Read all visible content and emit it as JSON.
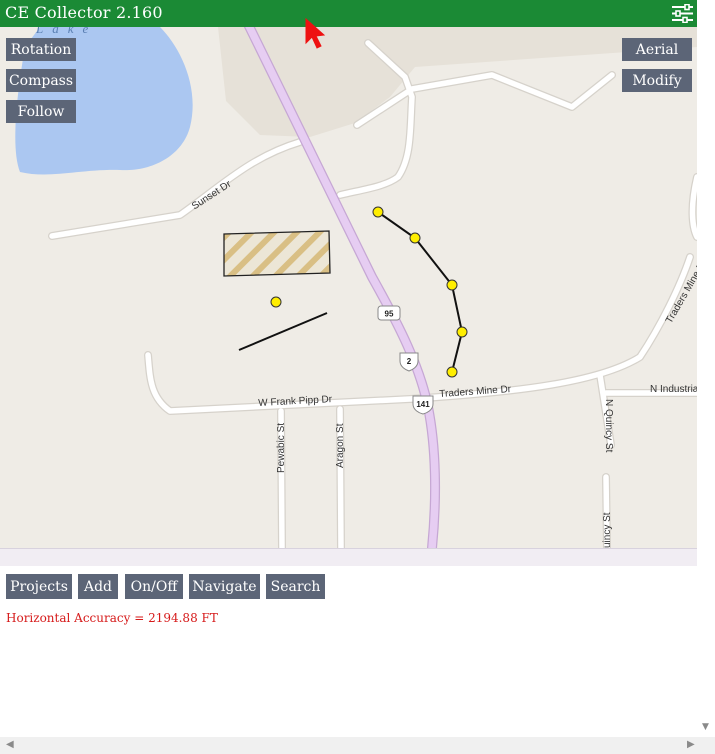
{
  "app": {
    "title": "CE Collector 2.160"
  },
  "map_controls": {
    "rotation": "Rotation",
    "compass": "Compass",
    "follow": "Follow",
    "aerial": "Aerial",
    "modify": "Modify"
  },
  "map_labels": {
    "lake": "Lake",
    "sunset_dr": "Sunset Dr",
    "w_frank_pipp_dr": "W Frank Pipp Dr",
    "traders_mine_dr": "Traders Mine Dr",
    "traders_mine_rd": "Traders Mine Rd",
    "n_industrial": "N Industrial",
    "pewabic_st": "Pewabic St",
    "aragon_st": "Aragon St",
    "n_quincy_st": "N Quincy St",
    "quincy_st": "uincy St"
  },
  "route_shields": {
    "hwy_95": "95",
    "us_2": "2",
    "us_141": "141"
  },
  "toolbar": {
    "projects": "Projects",
    "add": "Add",
    "onoff": "On/Off",
    "navigate": "Navigate",
    "search": "Search"
  },
  "status": {
    "horizontal_accuracy": "Horizontal Accuracy = 2194.88 FT"
  },
  "colors": {
    "header": "#1b8a35",
    "button": "#5c6577",
    "accuracy_text": "#d61a1a",
    "water": "#abc7f1",
    "highway": "#e6cdf2",
    "point": "#ffee00",
    "polygon_hatch": "#d9bf84"
  },
  "icons": {
    "settings": "sliders-icon",
    "cursor": "mouse-pointer-icon"
  }
}
